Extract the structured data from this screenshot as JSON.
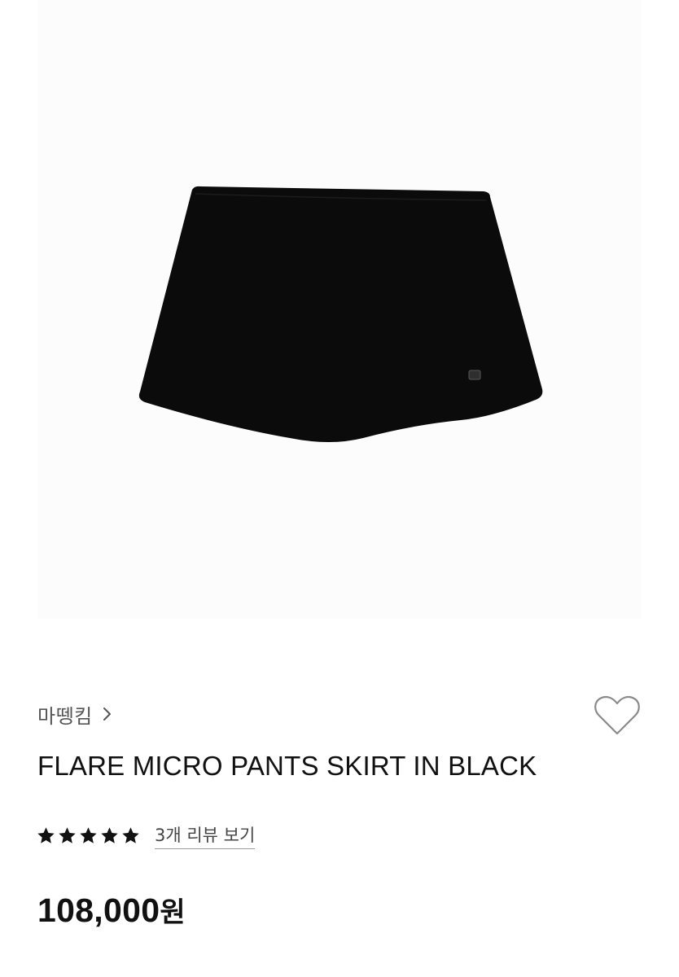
{
  "product": {
    "image_alt": "black flare micro pants skirt",
    "image_background": "#fcfcfc",
    "garment_color": "#0b0b0b",
    "brand": "마뗑킴",
    "brand_chevron_icon": "chevron-right-icon",
    "title": "FLARE MICRO PANTS SKIRT IN BLACK",
    "wishlist_icon": "heart-outline-icon",
    "rating": {
      "stars": 5,
      "max_stars": 5,
      "star_icon": "star-filled-icon",
      "review_link": "3개 리뷰 보기"
    },
    "price": {
      "amount": "108,000",
      "currency": "원"
    }
  }
}
